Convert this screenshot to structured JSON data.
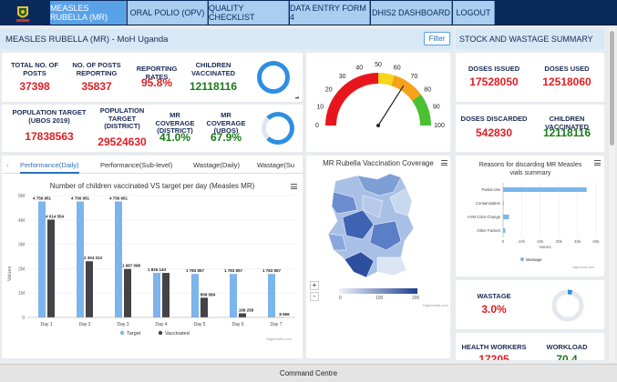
{
  "nav": {
    "tabs": [
      {
        "label": "MEASLES RUBELLA (MR)",
        "active": true
      },
      {
        "label": "ORAL POLIO (OPV)"
      },
      {
        "label": "QUALITY CHECKLIST"
      },
      {
        "label": "DATA ENTRY FORM 4"
      },
      {
        "label": "DHIS2 DASHBOARD"
      },
      {
        "label": "LOGOUT"
      }
    ]
  },
  "header": {
    "title": "MEASLES RUBELLA (MR) - MoH Uganda",
    "filter_label": "Filter",
    "right_title": "STOCK AND WASTAGE SUMMARY"
  },
  "kpis_row1": [
    {
      "label": "TOTAL NO. OF POSTS",
      "value": "37398",
      "color": "red"
    },
    {
      "label": "NO. OF POSTS REPORTING",
      "value": "35837",
      "color": "red"
    },
    {
      "label": "REPORTING RATES",
      "value": "95.8%",
      "color": "red"
    },
    {
      "label": "CHILDREN VACCINATED",
      "value": "12118116",
      "color": "green"
    }
  ],
  "kpis_row2": [
    {
      "label": "POPULATION TARGET (UBOS 2019)",
      "value": "17838563",
      "color": "red"
    },
    {
      "label": "POPULATION TARGET (DISTRICT)",
      "value": "29524630",
      "color": "red"
    },
    {
      "label": "MR COVERAGE (DISTRICT)",
      "value": "41.0%",
      "color": "green"
    },
    {
      "label": "MR COVERAGE (UBOS)",
      "value": "67.9%",
      "color": "green"
    }
  ],
  "gauge": {
    "ticks": [
      "0",
      "10",
      "20",
      "30",
      "40",
      "50",
      "60",
      "70",
      "80",
      "90",
      "100"
    ],
    "value": 68
  },
  "stock": [
    {
      "label": "DOSES ISSUED",
      "value": "17528050",
      "color": "red"
    },
    {
      "label": "DOSES USED",
      "value": "12518060",
      "color": "red"
    },
    {
      "label": "DOSES DISCARDED",
      "value": "542830",
      "color": "red"
    },
    {
      "label": "CHILDREN VACCINATED",
      "value": "12118116",
      "color": "green"
    }
  ],
  "wastage": {
    "label": "WASTAGE",
    "value": "3.0%",
    "fraction": 0.03
  },
  "bottom_right": [
    {
      "label": "HEALTH WORKERS",
      "value": "17205"
    },
    {
      "label": "WORKLOAD",
      "value": "70.4"
    }
  ],
  "subtabs": [
    "Performance(Daily)",
    "Performance(Sub-level)",
    "Wastage(Daily)",
    "Wastage(Su"
  ],
  "map": {
    "title": "MR Rubella Vaccination Coverage",
    "scale": [
      "0",
      "100",
      "200"
    ],
    "zoom_in": "+",
    "zoom_out": "-",
    "credit": "Highcharts.com"
  },
  "bar_chart_data": {
    "type": "bar",
    "title": "Number of children vaccinated VS target per day (Measles MR)",
    "categories": [
      "Day 1",
      "Day 2",
      "Day 3",
      "Day 4",
      "Day 5",
      "Day 6",
      "Day 7"
    ],
    "series": [
      {
        "name": "Target",
        "values": [
          4756951,
          4756951,
          4756951,
          1826143,
          1783857,
          1783857,
          1783857
        ],
        "labels": [
          "4 756 951",
          "4 756 951",
          "4 756 951",
          "1 826 143",
          "1 783 857",
          "1 783 857",
          "1 783 857"
        ],
        "color": "#7cb5ec"
      },
      {
        "name": "Vaccinated",
        "values": [
          4014554,
          2304313,
          1987098,
          1826143,
          809084,
          168258,
          8666
        ],
        "labels": [
          "4 014 554",
          "2 304 313",
          "1 987 098",
          "",
          "809 084",
          "168 258",
          "8 666"
        ],
        "color": "#434348"
      }
    ],
    "ylabel": "Values",
    "yticks": [
      "0",
      "1M",
      "2M",
      "3M",
      "4M",
      "5M"
    ],
    "ylim": [
      0,
      5000000
    ],
    "credit": "Highcharts.com"
  },
  "chart_data": {
    "type": "bar",
    "title": "Reasons for discarding MR Measles vials summary",
    "categories": [
      "Partial Use",
      "Contamination",
      "VVM Color Change",
      "Other Factors"
    ],
    "series": [
      {
        "name": "Wastage",
        "values": [
          45000,
          300,
          3200,
          1200
        ]
      }
    ],
    "xlabel": "Values",
    "xticks": [
      "0",
      "10k",
      "20k",
      "30k",
      "40k",
      "50k"
    ],
    "xlim": [
      0,
      50000
    ],
    "credit": "Highcharts.com"
  },
  "footer": {
    "label": "Command Centre"
  }
}
